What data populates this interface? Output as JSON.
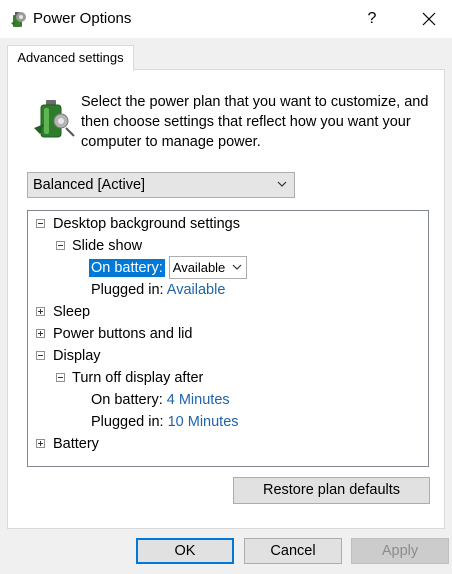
{
  "window": {
    "title": "Power Options",
    "help": "?"
  },
  "tab": {
    "label": "Advanced settings"
  },
  "intro": {
    "text": "Select the power plan that you want to customize, and then choose settings that reflect how you want your computer to manage power."
  },
  "plan_select": {
    "value": "Balanced [Active]"
  },
  "tree": {
    "desktop_background": "Desktop background settings",
    "slide_show": "Slide show",
    "on_battery_label": "On battery:",
    "on_battery_value": "Available",
    "plugged_in_label": "Plugged in:",
    "plugged_in_value": "Available",
    "sleep": "Sleep",
    "power_buttons": "Power buttons and lid",
    "display": "Display",
    "turn_off_display": "Turn off display after",
    "display_on_battery_label": "On battery:",
    "display_on_battery_value": "4 Minutes",
    "display_plugged_in_label": "Plugged in:",
    "display_plugged_in_value": "10 Minutes",
    "battery": "Battery"
  },
  "buttons": {
    "restore": "Restore plan defaults",
    "ok": "OK",
    "cancel": "Cancel",
    "apply": "Apply"
  },
  "colors": {
    "accent": "#0078d7",
    "link": "#1f63a8"
  }
}
